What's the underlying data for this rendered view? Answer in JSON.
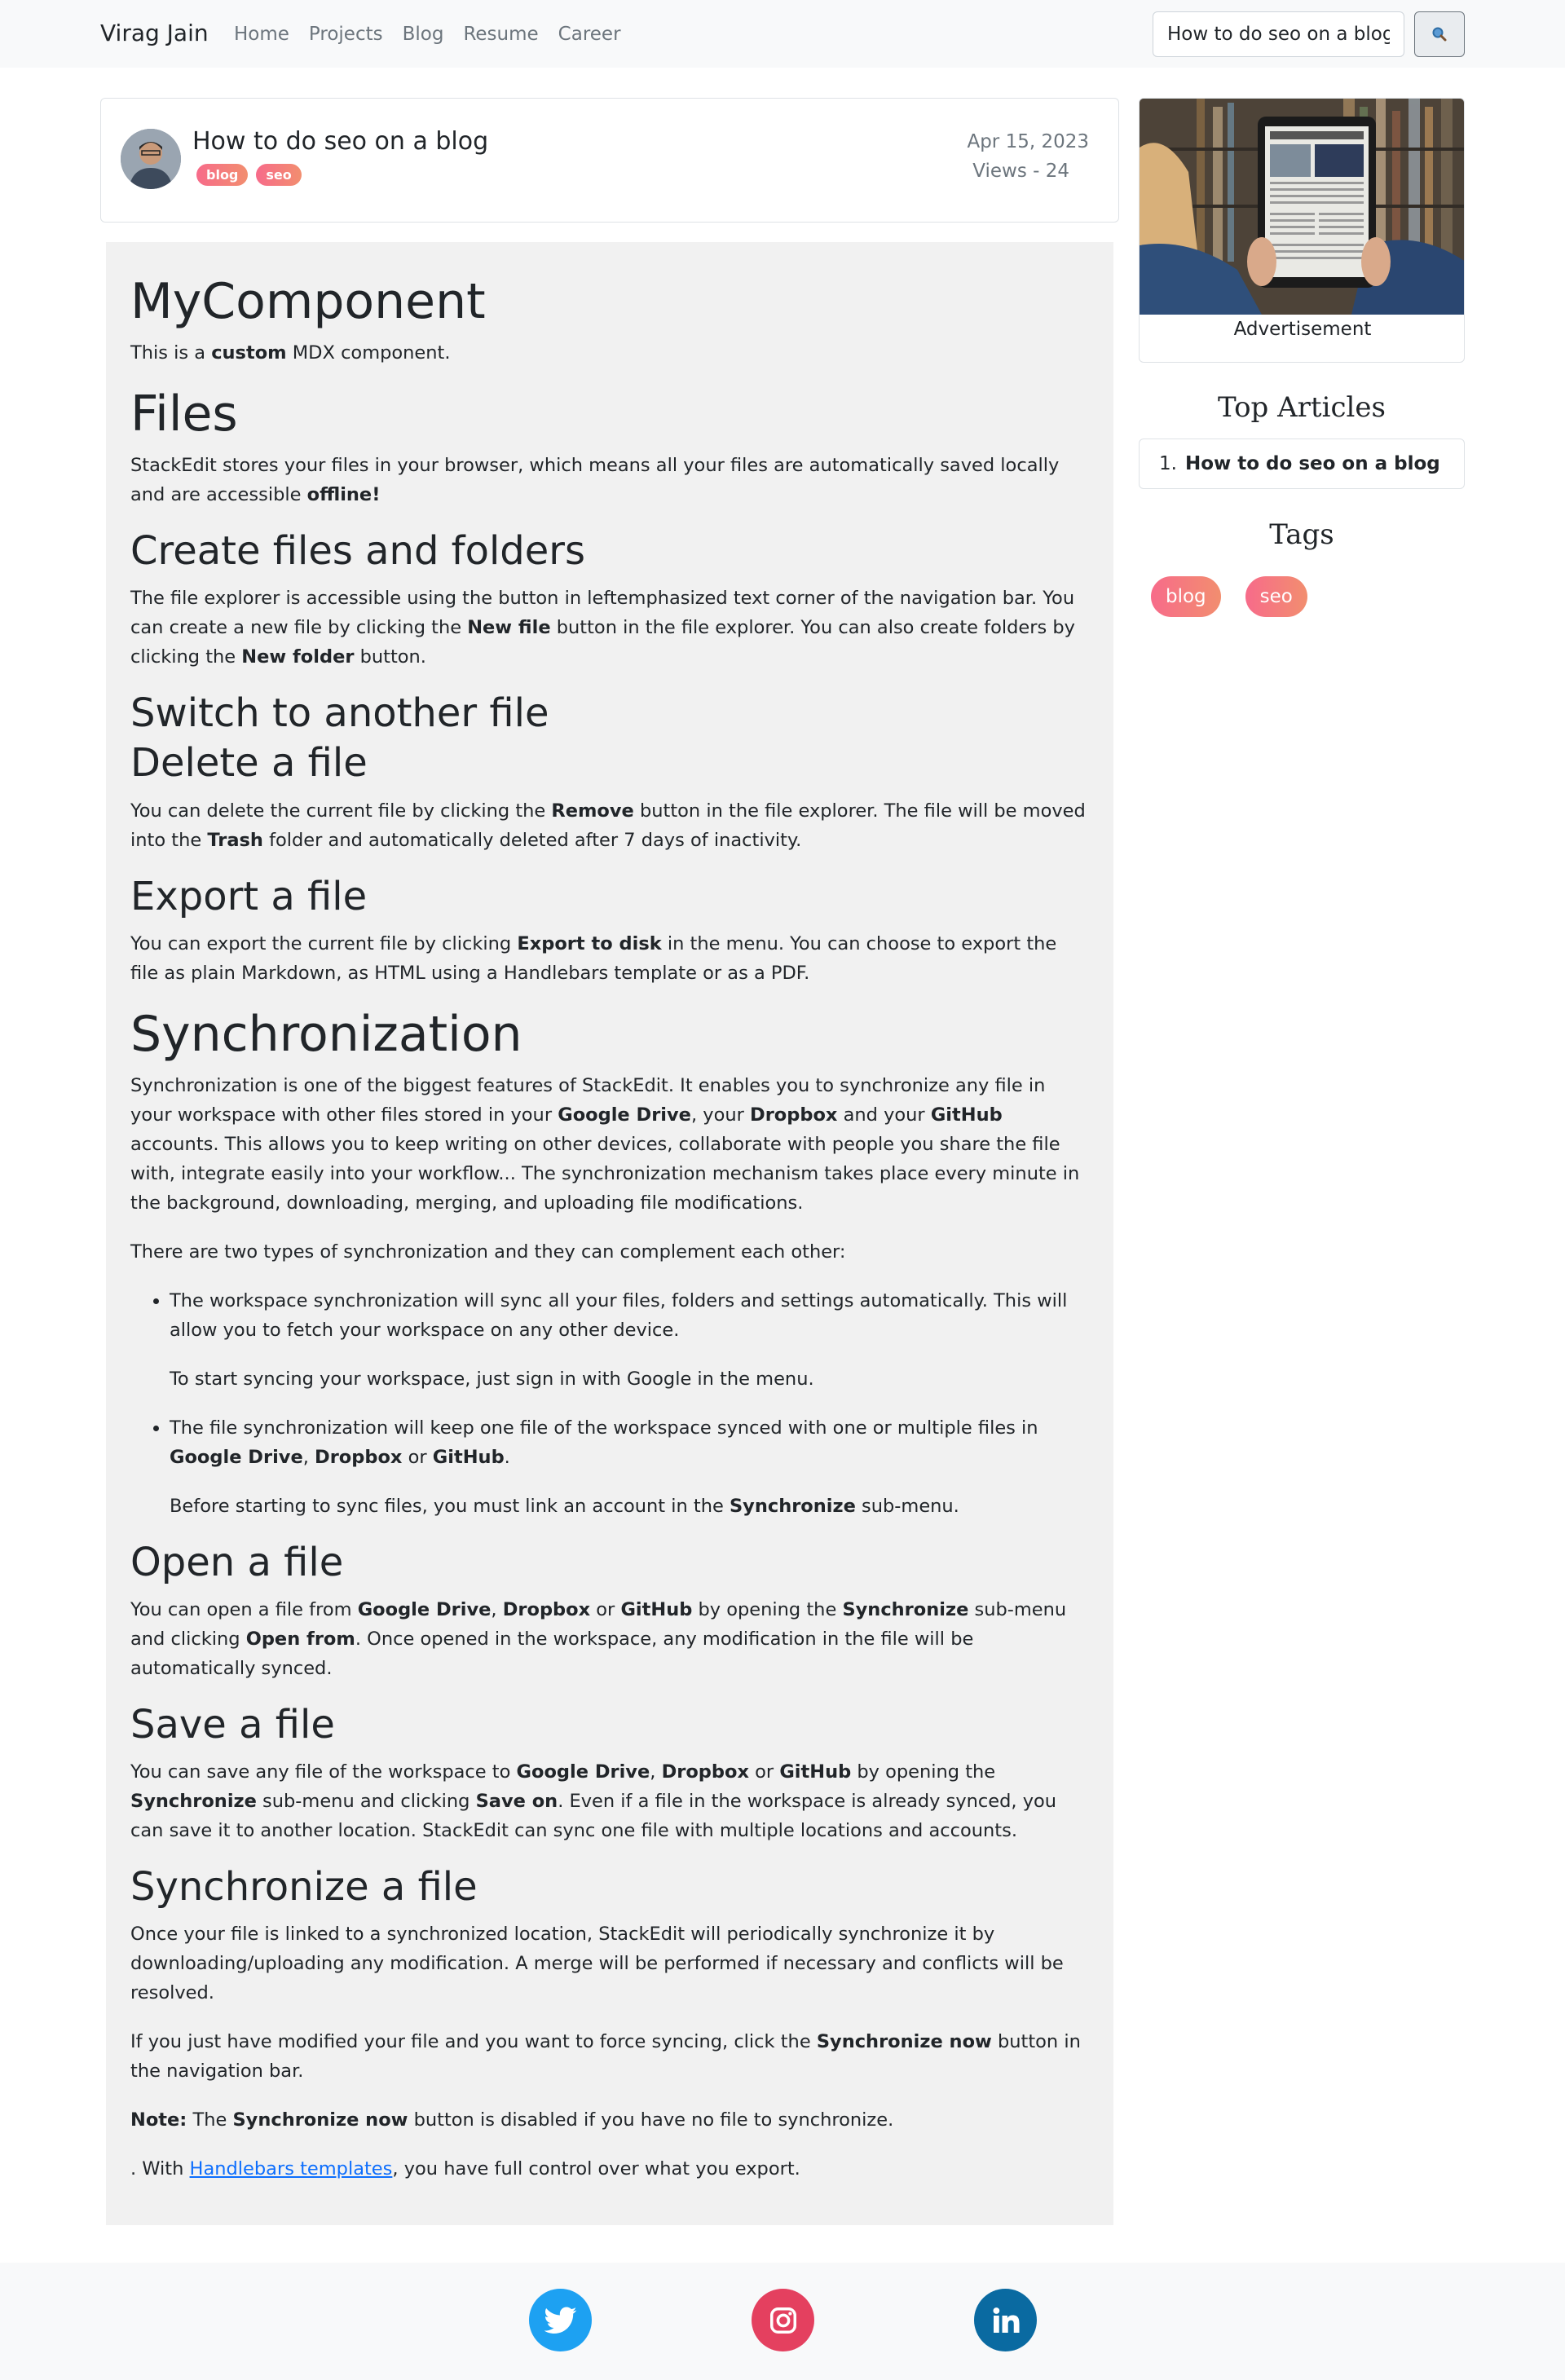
{
  "nav": {
    "brand": "Virag Jain",
    "links": [
      "Home",
      "Projects",
      "Blog",
      "Resume",
      "Career"
    ],
    "search_value": "How to do seo on a blog"
  },
  "post": {
    "title": "How to do seo on a blog",
    "badges": [
      "blog",
      "seo"
    ],
    "date": "Apr 15, 2023",
    "views": "Views - 24"
  },
  "article": {
    "h_mycomponent": "MyComponent",
    "p_mycomponent": [
      "This is a ",
      "custom",
      " MDX component."
    ],
    "h_files": "Files",
    "p_files": [
      "StackEdit stores your files in your browser, which means all your files are automatically saved locally and are accessible ",
      "offline!"
    ],
    "h_create": "Create files and folders",
    "p_create": [
      "The file explorer is accessible using the button in leftemphasized text corner of the navigation bar. You can create a new file by clicking the ",
      "New file",
      " button in the file explorer. You can also create folders by clicking the ",
      "New folder",
      " button."
    ],
    "h_switch": "Switch to another file",
    "h_delete": "Delete a file",
    "p_delete": [
      "You can delete the current file by clicking the ",
      "Remove",
      " button in the file explorer. The file will be moved into the ",
      "Trash",
      " folder and automatically deleted after 7 days of inactivity."
    ],
    "h_export": "Export a file",
    "p_export": [
      "You can export the current file by clicking ",
      "Export to disk",
      " in the menu. You can choose to export the file as plain Markdown, as HTML using a Handlebars template or as a PDF."
    ],
    "h_sync": "Synchronization",
    "p_sync": [
      "Synchronization is one of the biggest features of StackEdit. It enables you to synchronize any file in your workspace with other files stored in your ",
      "Google Drive",
      ", your ",
      "Dropbox",
      " and your ",
      "GitHub",
      " accounts. This allows you to keep writing on other devices, collaborate with people you share the file with, integrate easily into your workflow... The synchronization mechanism takes place every minute in the background, downloading, merging, and uploading file modifications."
    ],
    "p_two_types": "There are two types of synchronization and they can complement each other:",
    "li1_a": "The workspace synchronization will sync all your files, folders and settings automatically. This will allow you to fetch your workspace on any other device.",
    "li1_b": "To start syncing your workspace, just sign in with Google in the menu.",
    "li2_a": [
      "The file synchronization will keep one file of the workspace synced with one or multiple files in ",
      "Google Drive",
      ", ",
      "Dropbox",
      " or ",
      "GitHub",
      "."
    ],
    "li2_b": [
      "Before starting to sync files, you must link an account in the ",
      "Synchronize",
      " sub-menu."
    ],
    "h_open": "Open a file",
    "p_open": [
      "You can open a file from ",
      "Google Drive",
      ", ",
      "Dropbox",
      " or ",
      "GitHub",
      " by opening the ",
      "Synchronize",
      " sub-menu and clicking ",
      "Open from",
      ". Once opened in the workspace, any modification in the file will be automatically synced."
    ],
    "h_save": "Save a file",
    "p_save": [
      "You can save any file of the workspace to ",
      "Google Drive",
      ", ",
      "Dropbox",
      " or ",
      "GitHub",
      " by opening the ",
      "Synchronize",
      " sub-menu and clicking ",
      "Save on",
      ". Even if a file in the workspace is already synced, you can save it to another location. StackEdit can sync one file with multiple locations and accounts."
    ],
    "h_syncfile": "Synchronize a file",
    "p_syncfile1": "Once your file is linked to a synchronized location, StackEdit will periodically synchronize it by downloading/uploading any modification. A merge will be performed if necessary and conflicts will be resolved.",
    "p_syncfile2": [
      "If you just have modified your file and you want to force syncing, click the ",
      "Synchronize now",
      " button in the navigation bar."
    ],
    "p_note": [
      "Note:",
      " The ",
      "Synchronize now",
      " button is disabled if you have no file to synchronize."
    ],
    "p_last": [
      ". With ",
      "Handlebars templates",
      ", you have full control over what you export."
    ]
  },
  "sidebar": {
    "ad_label": "Advertisement",
    "top_title": "Top Articles",
    "top_items": [
      {
        "num": "1.",
        "title": "How to do seo on a blog"
      }
    ],
    "tags_title": "Tags",
    "tags": [
      "blog",
      "seo"
    ]
  },
  "footer": {
    "icons": [
      "twitter-icon",
      "instagram-icon",
      "linkedin-icon"
    ]
  },
  "colors": {
    "twitter": "#1da1f2",
    "instagram": "#e4405f",
    "linkedin": "#0077b5",
    "badge_gradient": [
      "#f76b8a",
      "#f28e6f"
    ],
    "link": "#0d6efd"
  }
}
